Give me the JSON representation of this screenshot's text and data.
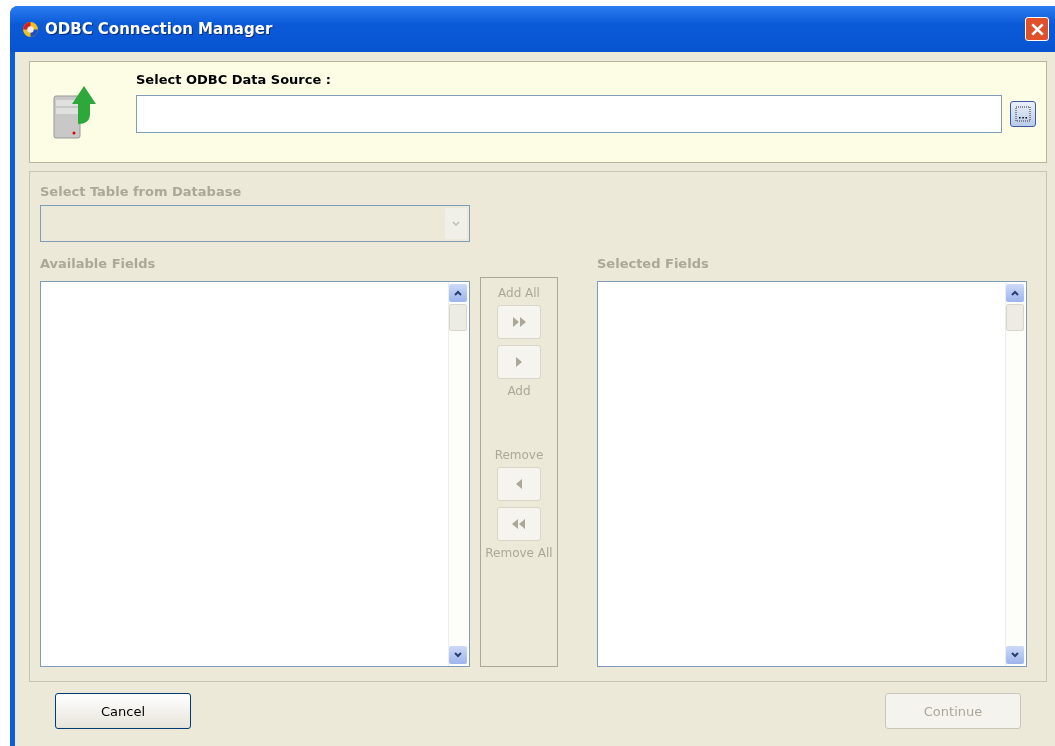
{
  "window": {
    "title": "ODBC Connection Manager"
  },
  "source": {
    "label": "Select ODBC Data Source :"
  },
  "table": {
    "label": "Select Table from Database",
    "disabled": true
  },
  "available": {
    "label": "Available Fields",
    "disabled": true
  },
  "selected": {
    "label": "Selected Fields",
    "disabled": true
  },
  "transfer": [
    {
      "label": "Add All",
      "kind": "add_all",
      "disabled": true
    },
    {
      "label": "Add",
      "kind": "add",
      "disabled": true
    },
    {
      "label": "Remove",
      "kind": "remove",
      "disabled": true
    },
    {
      "label": "Remove All",
      "kind": "remove_all",
      "disabled": true
    }
  ],
  "buttons": [
    {
      "label": "Cancel",
      "kind": "cancel",
      "disabled": false
    },
    {
      "label": "Continue",
      "kind": "continue",
      "disabled": true
    }
  ]
}
